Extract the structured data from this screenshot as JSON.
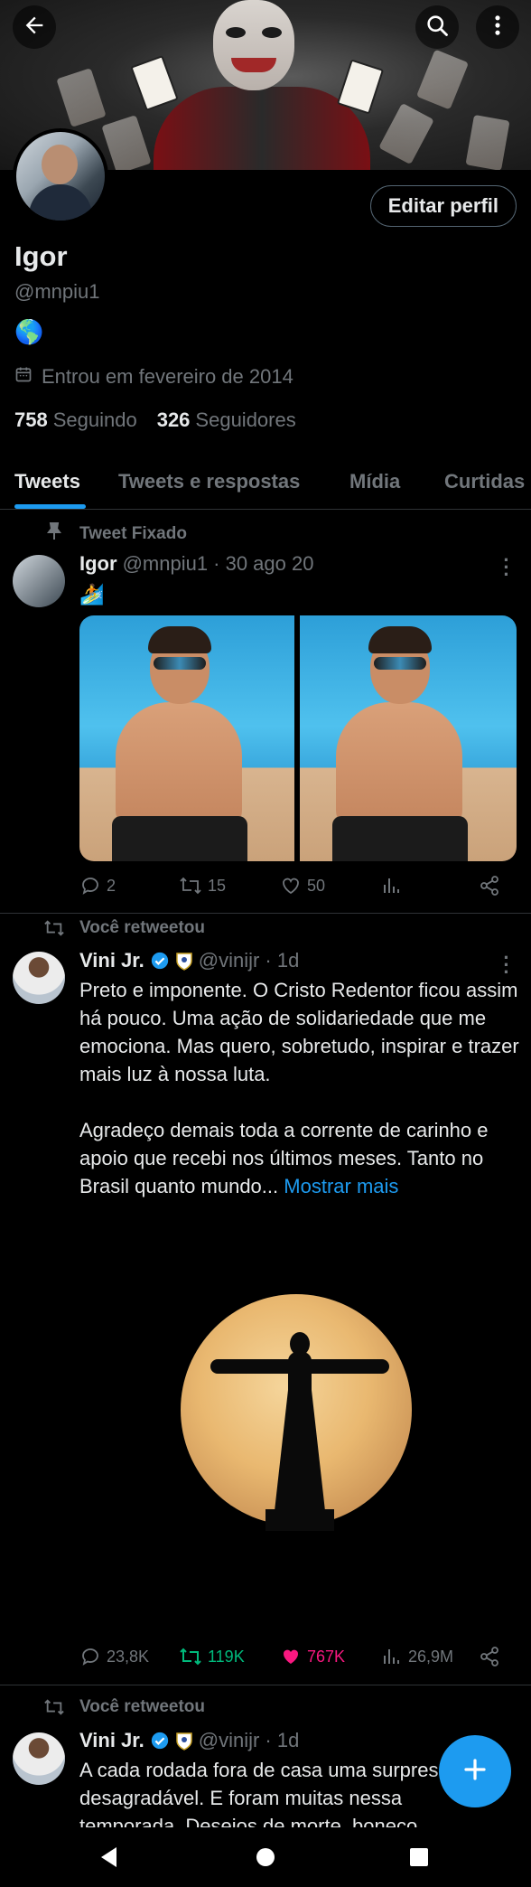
{
  "header": {
    "back_icon": "arrow-left-icon",
    "search_icon": "search-icon",
    "more_icon": "more-vertical-icon"
  },
  "profile": {
    "edit_button": "Editar perfil",
    "name": "Igor",
    "handle": "@mnpiu1",
    "bio_emoji": "🌎",
    "joined": "Entrou em fevereiro de 2014",
    "following_count": "758",
    "following_label": "Seguindo",
    "followers_count": "326",
    "followers_label": "Seguidores"
  },
  "tabs": [
    "Tweets",
    "Tweets e respostas",
    "Mídia",
    "Curtidas"
  ],
  "tweets": [
    {
      "context": "Tweet Fixado",
      "author": "Igor",
      "handle": "@mnpiu1 · 30 ago 20",
      "text": "🏄",
      "replies": "2",
      "retweets": "15",
      "likes": "50"
    },
    {
      "context": "Você retweetou",
      "author": "Vini Jr.",
      "handle": "@vinijr · 1d",
      "text": "Preto e imponente. O Cristo Redentor ficou assim há pouco. Uma ação de solidariedade que me emociona. Mas quero, sobretudo, inspirar e trazer mais luz à nossa luta.\n\nAgradeço demais toda a corrente de carinho e apoio que recebi nos últimos meses. Tanto no Brasil quanto mundo...",
      "show_more": "Mostrar mais",
      "replies": "23,8K",
      "retweets": "119K",
      "likes": "767K",
      "views": "26,9M"
    },
    {
      "context": "Você retweetou",
      "author": "Vini Jr.",
      "handle": "@vinijr · 1d",
      "text": "A cada rodada fora de casa uma surpresa desagradável. E foram muitas nessa temporada. Desejos de morte, boneco"
    }
  ],
  "colors": {
    "accent": "#1d9bf0",
    "retweet_green": "#00ba7c",
    "like_pink": "#f91880",
    "muted": "#71767b"
  }
}
